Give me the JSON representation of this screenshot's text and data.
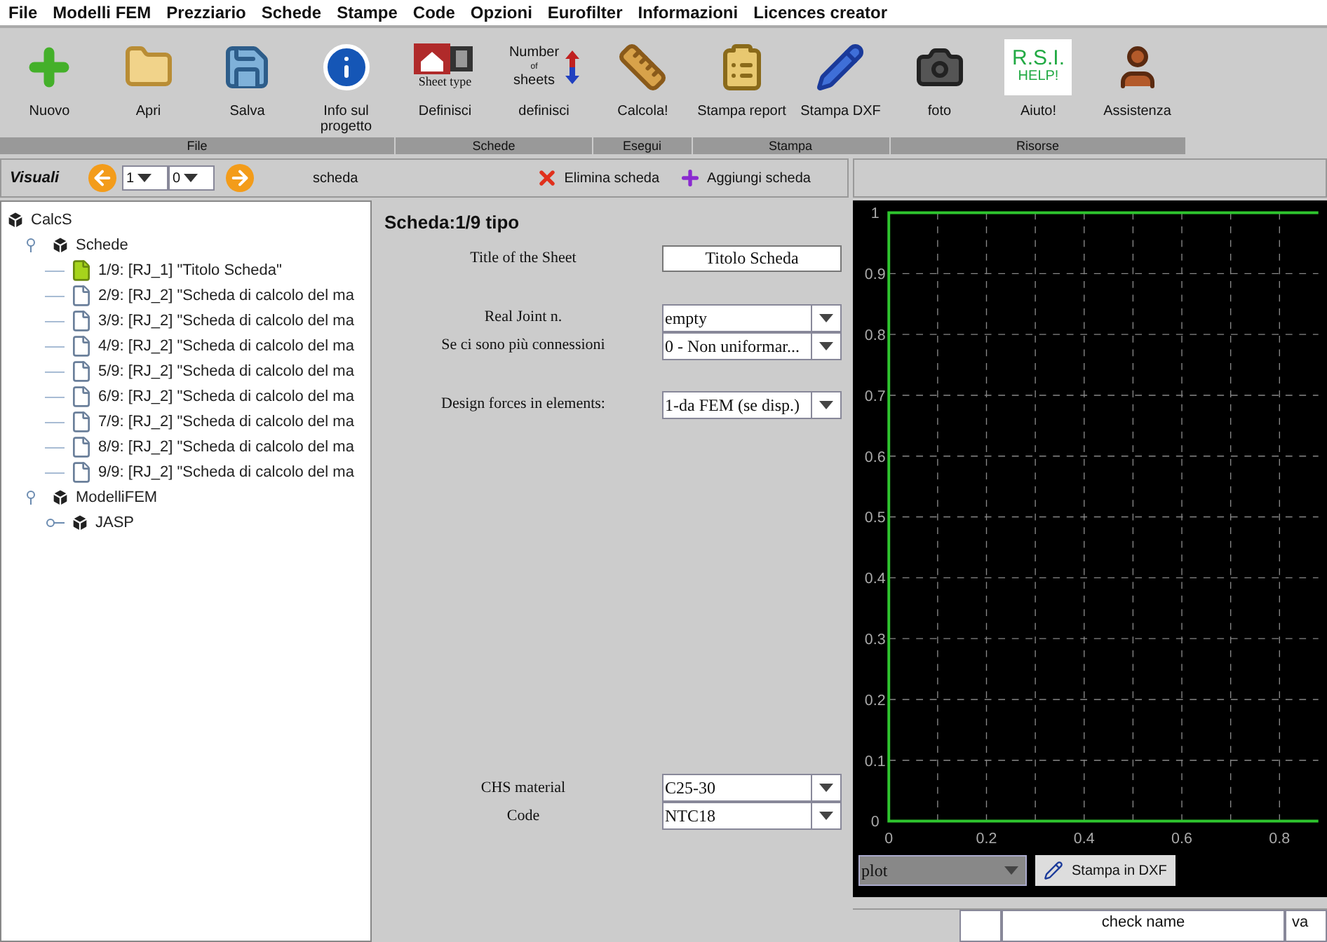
{
  "menu": [
    "File",
    "Modelli FEM",
    "Prezziario",
    "Schede",
    "Stampe",
    "Code",
    "Opzioni",
    "Eurofilter",
    "Informazioni",
    "Licences creator"
  ],
  "toolbar": {
    "groups": [
      {
        "label": "File",
        "buttons": [
          {
            "kind": "plus",
            "label": "Nuovo"
          },
          {
            "kind": "folder",
            "label": "Apri"
          },
          {
            "kind": "save",
            "label": "Salva"
          },
          {
            "kind": "info",
            "label": "Info sul progetto"
          }
        ]
      },
      {
        "label": "Schede",
        "buttons": [
          {
            "kind": "sheettype",
            "label": "Definisci",
            "icon_text": [
              "Sheet type"
            ]
          },
          {
            "kind": "numsheets",
            "label": "definisci",
            "icon_text": [
              "Number",
              "of",
              "sheets"
            ]
          }
        ]
      },
      {
        "label": "Esegui",
        "buttons": [
          {
            "kind": "ruler",
            "label": "Calcola!"
          }
        ]
      },
      {
        "label": "Stampa",
        "buttons": [
          {
            "kind": "report",
            "label": "Stampa report"
          },
          {
            "kind": "pencil",
            "label": "Stampa DXF"
          }
        ]
      },
      {
        "label": "Risorse",
        "buttons": [
          {
            "kind": "camera",
            "label": "foto"
          },
          {
            "kind": "help",
            "label": "Aiuto!",
            "icon_text": [
              "R.S.I.",
              "HELP!"
            ]
          },
          {
            "kind": "person",
            "label": "Assistenza"
          }
        ]
      }
    ]
  },
  "navbar": {
    "title": "Visuali",
    "spinner_1": "1",
    "spinner_2": "0",
    "label": "scheda",
    "delete_button": "Elimina scheda",
    "add_button": "Aggiungi scheda"
  },
  "tree": [
    {
      "label": "CalcS",
      "kind": "cube",
      "children": [
        {
          "label": "Schede",
          "kind": "cube",
          "expanded": true,
          "children": [
            {
              "label": "1/9: [RJ_1] \"Titolo Scheda\"",
              "kind": "sheet",
              "selected": true
            },
            {
              "label": "2/9: [RJ_2] \"Scheda di calcolo del ma",
              "kind": "sheet",
              "selected": false
            },
            {
              "label": "3/9: [RJ_2] \"Scheda di calcolo del ma",
              "kind": "sheet",
              "selected": false
            },
            {
              "label": "4/9: [RJ_2] \"Scheda di calcolo del ma",
              "kind": "sheet",
              "selected": false
            },
            {
              "label": "5/9: [RJ_2] \"Scheda di calcolo del ma",
              "kind": "sheet",
              "selected": false
            },
            {
              "label": "6/9: [RJ_2] \"Scheda di calcolo del ma",
              "kind": "sheet",
              "selected": false
            },
            {
              "label": "7/9: [RJ_2] \"Scheda di calcolo del ma",
              "kind": "sheet",
              "selected": false
            },
            {
              "label": "8/9: [RJ_2] \"Scheda di calcolo del ma",
              "kind": "sheet",
              "selected": false
            },
            {
              "label": "9/9: [RJ_2] \"Scheda di calcolo del ma",
              "kind": "sheet",
              "selected": false
            }
          ]
        },
        {
          "label": "ModelliFEM",
          "kind": "cube",
          "expanded": true,
          "children": [
            {
              "label": "JASP",
              "kind": "cube",
              "expanded": false
            }
          ]
        }
      ]
    }
  ],
  "form": {
    "title": "Scheda:1/9 tipo",
    "sections": [
      [
        {
          "label": "Title of the Sheet",
          "kind": "text",
          "value": "Titolo Scheda"
        }
      ],
      [
        {
          "label": "Real Joint n.",
          "kind": "select",
          "value": "empty"
        },
        {
          "label": "Se ci sono più connessioni",
          "kind": "select",
          "value": "0 - Non uniformar..."
        }
      ],
      [
        {
          "label": "Design forces in elements:",
          "kind": "select",
          "value": "1-da FEM (se disp.)"
        }
      ],
      [
        {
          "label": "CHS material",
          "kind": "select",
          "value": "C25-30"
        },
        {
          "label": "Code",
          "kind": "select",
          "value": "NTC18"
        }
      ]
    ]
  },
  "chart_data": {
    "type": "line",
    "grid": true,
    "xlim": [
      0,
      0.88
    ],
    "ylim": [
      0,
      1
    ],
    "xticks": [
      0,
      0.2,
      0.4,
      0.6,
      0.8
    ],
    "yticks": [
      0,
      0.1,
      0.2,
      0.3,
      0.4,
      0.5,
      0.6,
      0.7,
      0.8,
      0.9,
      1
    ]
  },
  "plot_select": "plot",
  "dxf_button": "Stampa in DXF",
  "table": {
    "columns": [
      "check name",
      "va"
    ]
  }
}
